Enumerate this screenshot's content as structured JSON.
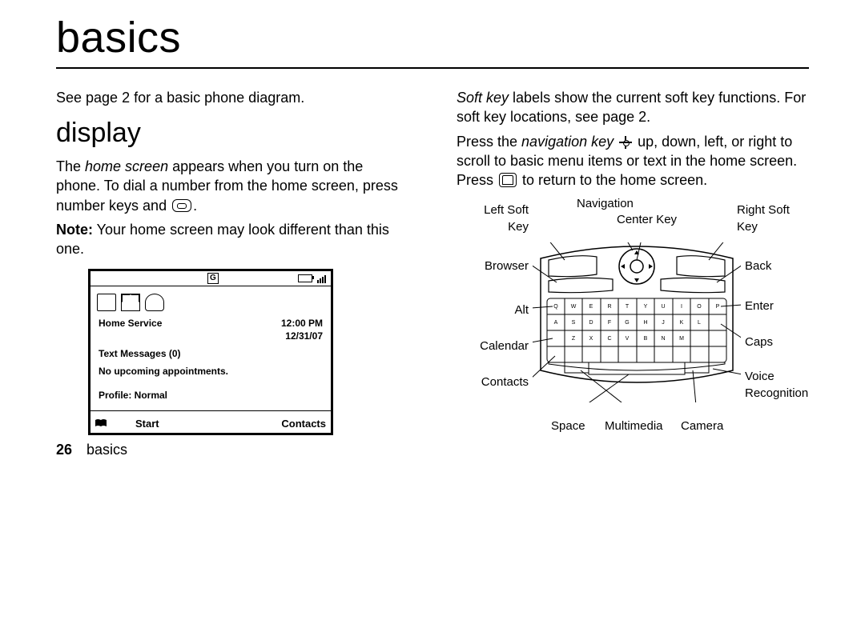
{
  "title": "basics",
  "left": {
    "intro": "See page 2 for a basic phone diagram.",
    "heading": "display",
    "p1_a": "The ",
    "p1_i": "home screen",
    "p1_b": " appears when you turn on the phone. To dial a number from the home screen, press number keys and ",
    "p1_end": ".",
    "note_b": "Note:",
    "note_t": " Your home screen may look different than this one.",
    "phone": {
      "g": "G",
      "home": "Home Service",
      "time": "12:00 PM",
      "date": "12/31/07",
      "msgs": "Text Messages (0)",
      "appts": "No upcoming appointments.",
      "profile": "Profile: Normal",
      "soft_left": "Start",
      "soft_right": "Contacts"
    },
    "page_num": "26",
    "footer": "basics"
  },
  "right": {
    "p1_i": "Soft key",
    "p1_t": " labels show the current soft key functions. For soft key locations, see page 2.",
    "p2_a": "Press the ",
    "p2_i": "navigation key",
    "p2_b": " up, down, left, or right to scroll to basic menu items or text in the home screen. Press ",
    "p2_c": " to return to the home screen.",
    "labels": {
      "l_soft": "Left Soft\nKey",
      "nav": "Navigation",
      "center": "Center Key",
      "r_soft": "Right Soft\nKey",
      "browser": "Browser",
      "back": "Back",
      "alt": "Alt",
      "enter": "Enter",
      "calendar": "Calendar",
      "caps": "Caps",
      "contacts": "Contacts",
      "voice": "Voice\nRecognition",
      "space": "Space",
      "multimedia": "Multimedia",
      "camera": "Camera"
    }
  }
}
